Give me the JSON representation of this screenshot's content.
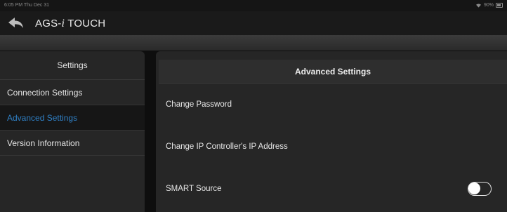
{
  "status_bar": {
    "time_date": "6:05 PM  Thu Dec 31",
    "battery": "90%",
    "wifi_icon": "wifi-icon",
    "battery_icon": "battery-icon"
  },
  "header": {
    "back_icon": "back-arrow-icon",
    "title_prefix": "AGS-",
    "title_italic": "i",
    "title_suffix": " TOUCH"
  },
  "sidebar": {
    "title": "Settings",
    "items": [
      {
        "label": "Connection Settings",
        "active": false
      },
      {
        "label": "Advanced Settings",
        "active": true
      },
      {
        "label": "Version Information",
        "active": false
      }
    ]
  },
  "main": {
    "title": "Advanced Settings",
    "rows": [
      {
        "label": "Change Password"
      },
      {
        "label": "Change IP Controller's IP Address"
      },
      {
        "label": "SMART Source",
        "toggle": "off"
      }
    ]
  },
  "colors": {
    "accent": "#2f7fc4",
    "panel": "#262626",
    "background": "#0e0e0e"
  }
}
